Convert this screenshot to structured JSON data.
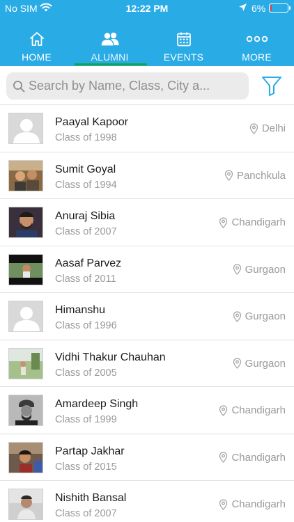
{
  "status_bar": {
    "carrier": "No SIM",
    "time": "12:22 PM",
    "battery_percent": "6%",
    "battery_level": 0.06,
    "icons": [
      "wifi-icon",
      "location-arrow-icon",
      "battery-icon"
    ]
  },
  "tabs": [
    {
      "label": "HOME",
      "icon": "home-icon",
      "active": false
    },
    {
      "label": "ALUMNI",
      "icon": "people-icon",
      "active": true
    },
    {
      "label": "EVENTS",
      "icon": "calendar-icon",
      "active": false
    },
    {
      "label": "MORE",
      "icon": "more-dots-icon",
      "active": false
    }
  ],
  "search": {
    "placeholder": "Search by Name, Class, City a...",
    "value": "",
    "icon": "search-icon",
    "filter_icon": "filter-icon"
  },
  "alumni": [
    {
      "name": "Paayal Kapoor",
      "class": "Class of 1998",
      "city": "Delhi",
      "avatar": "placeholder"
    },
    {
      "name": "Sumit Goyal",
      "class": "Class of 1994",
      "city": "Panchkula",
      "avatar": "photo"
    },
    {
      "name": "Anuraj Sibia",
      "class": "Class of 2007",
      "city": "Chandigarh",
      "avatar": "photo"
    },
    {
      "name": "Aasaf Parvez",
      "class": "Class of 2011",
      "city": "Gurgaon",
      "avatar": "photo"
    },
    {
      "name": "Himanshu",
      "class": "Class of 1996",
      "city": "Gurgaon",
      "avatar": "placeholder"
    },
    {
      "name": "Vidhi Thakur Chauhan",
      "class": "Class of 2005",
      "city": "Gurgaon",
      "avatar": "photo"
    },
    {
      "name": "Amardeep Singh",
      "class": "Class of 1999",
      "city": "Chandigarh",
      "avatar": "photo"
    },
    {
      "name": "Partap Jakhar",
      "class": "Class of 2015",
      "city": "Chandigarh",
      "avatar": "photo"
    },
    {
      "name": "Nishith Bansal",
      "class": "Class of 2007",
      "city": "Chandigarh",
      "avatar": "photo"
    }
  ],
  "colors": {
    "header_blue": "#29abe6",
    "active_tab_underline": "#16a44a",
    "battery_low": "#ff3b30",
    "secondary_text": "#9a9a9a"
  }
}
